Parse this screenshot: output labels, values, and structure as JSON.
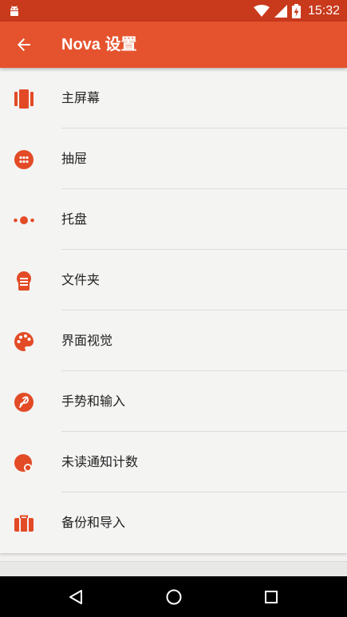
{
  "status_bar": {
    "time": "15:32",
    "icons": [
      "android-icon",
      "wifi-icon",
      "signal-icon",
      "battery-charging-icon"
    ]
  },
  "app_bar": {
    "title": "Nova 设置",
    "back_icon": "arrow-back-icon"
  },
  "colors": {
    "status_bar": "#c9391c",
    "app_bar": "#e5532e",
    "accent_icon": "#e24b26",
    "background": "#f4f4f3"
  },
  "settings": {
    "items": [
      {
        "label": "主屏幕",
        "icon": "home-screen-icon"
      },
      {
        "label": "抽屉",
        "icon": "app-drawer-icon"
      },
      {
        "label": "托盘",
        "icon": "dock-icon"
      },
      {
        "label": "文件夹",
        "icon": "folder-icon"
      },
      {
        "label": "界面视觉",
        "icon": "palette-icon"
      },
      {
        "label": "手势和输入",
        "icon": "gesture-icon"
      },
      {
        "label": "未读通知计数",
        "icon": "unread-badge-icon"
      },
      {
        "label": "备份和导入",
        "icon": "backup-icon"
      }
    ]
  },
  "nav_bar": {
    "buttons": [
      "back-triangle-icon",
      "home-circle-icon",
      "recents-square-icon"
    ]
  }
}
